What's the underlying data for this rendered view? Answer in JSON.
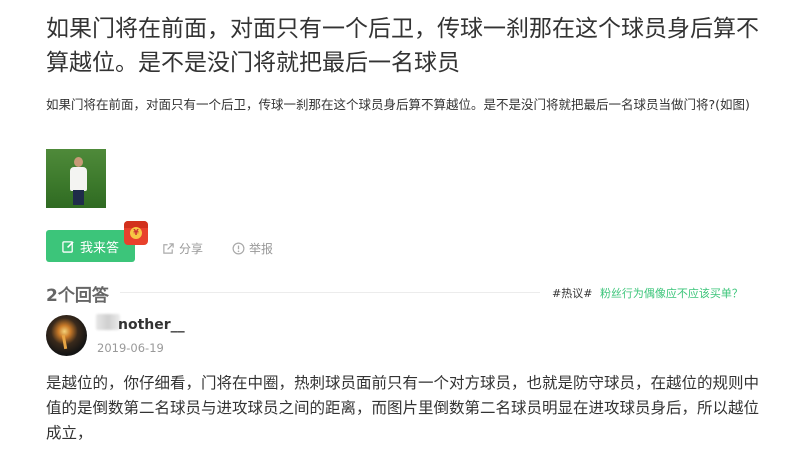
{
  "question": {
    "title": "如果门将在前面，对面只有一个后卫，传球一刹那在这个球员身后算不算越位。是不是没门将就把最后一名球员",
    "description": "如果门将在前面，对面只有一个后卫，传球一刹那在这个球员身后算不算越位。是不是没门将就把最后一名球员当做门将?(如图)"
  },
  "actions": {
    "answer_label": "我来答",
    "share_label": "分享",
    "report_label": "举报",
    "red_packet_icon": "red-packet-icon",
    "accent_color": "#3cc57a"
  },
  "answers_section": {
    "count_label": "2个回答",
    "hot_tag": "#热议#",
    "hot_link": "粉丝行为偶像应不应该买单？"
  },
  "answer": {
    "username": "nother__",
    "date": "2019-06-19",
    "text": "是越位的，你仔细看，门将在中圈，热刺球员面前只有一个对方球员，也就是防守球员，在越位的规则中值的是倒数第二名球员与进攻球员之间的距离，而图片里倒数第二名球员明显在进攻球员身后，所以越位成立，"
  }
}
